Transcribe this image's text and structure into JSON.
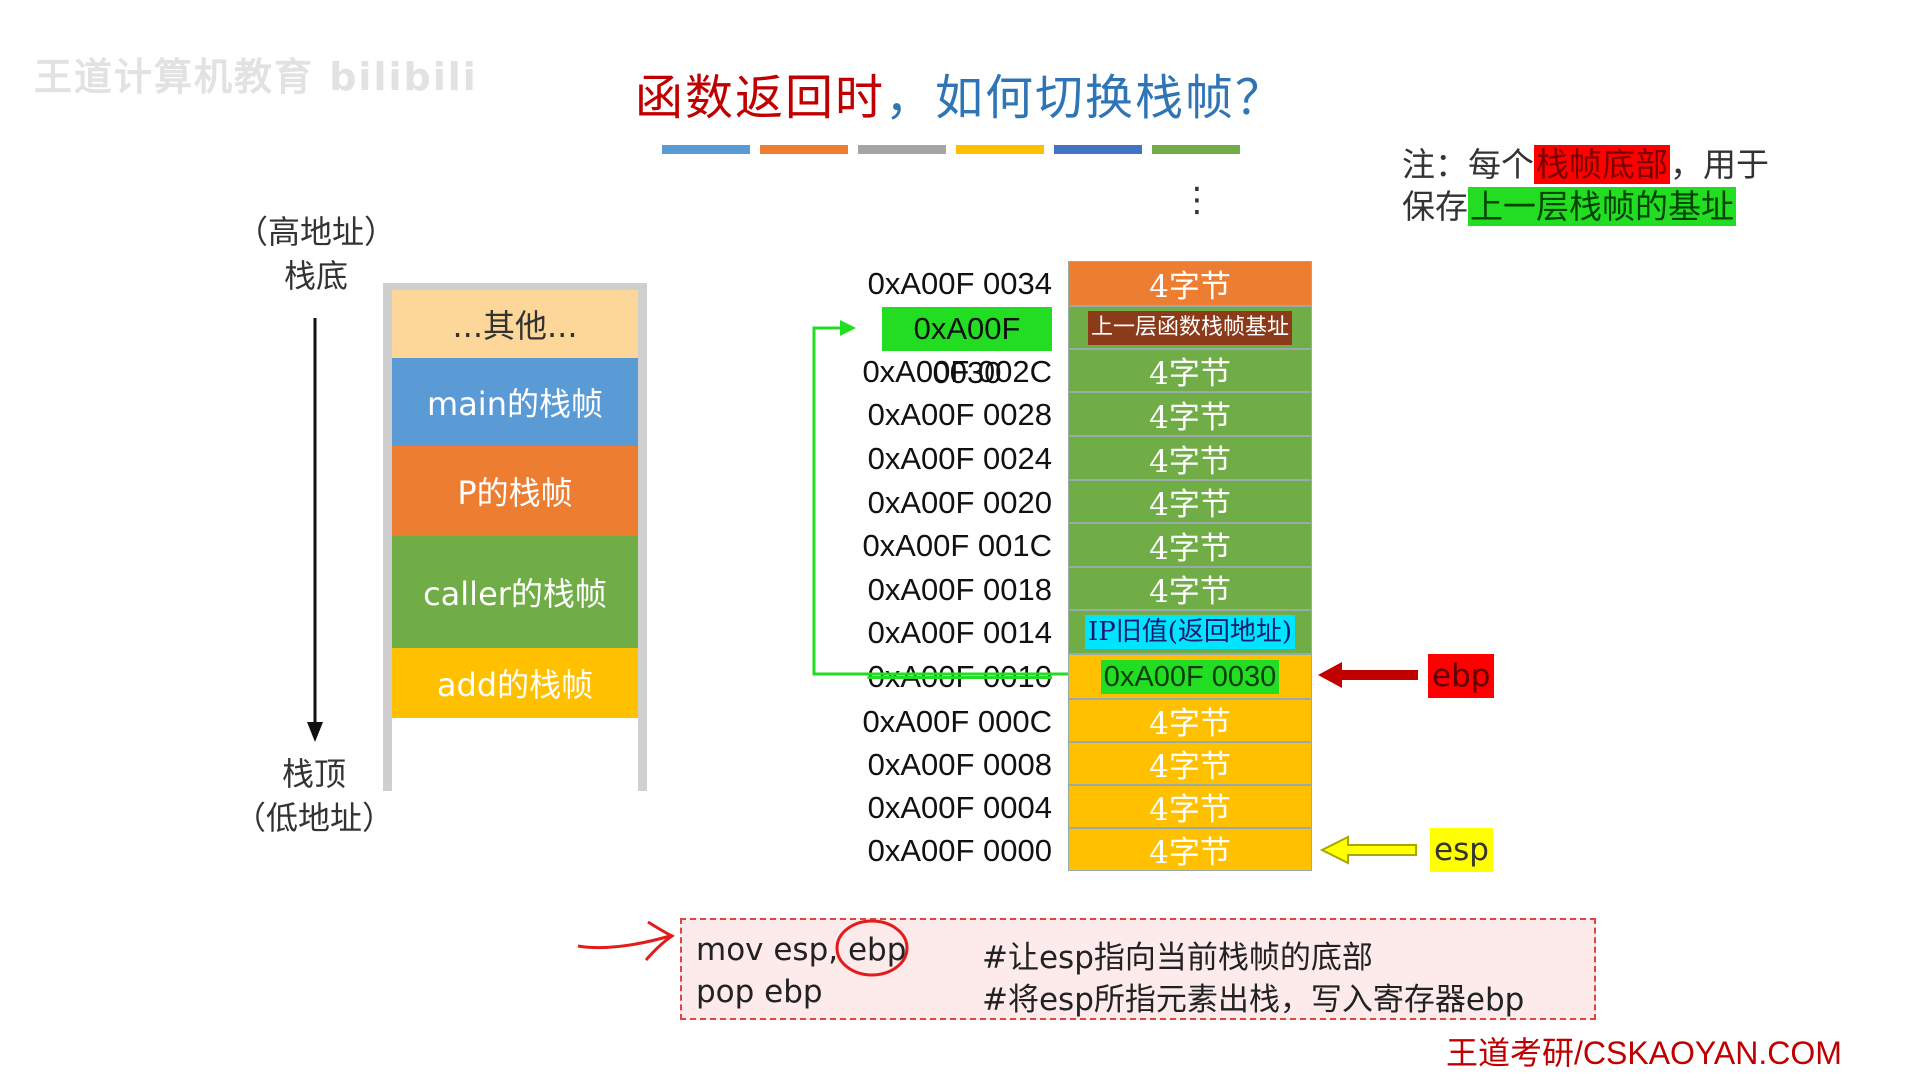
{
  "watermark": "王道计算机教育 bilibili",
  "title": {
    "prefix": "函数返回时",
    "suffix": "，如何切换栈帧？"
  },
  "color_bars": [
    "#5b9bd5",
    "#ed7d31",
    "#a5a5a5",
    "#ffc000",
    "#4472c4",
    "#70ad47"
  ],
  "note": {
    "line1_pre": "注：每个",
    "line1_hl": "栈帧底部",
    "line1_post": "，用于",
    "line2_pre": "保存",
    "line2_hl": "上一层栈帧的基址"
  },
  "stack_labels": {
    "top_paren": "（高地址）",
    "top": "栈底",
    "bottom": "栈顶",
    "bottom_paren": "（低地址）"
  },
  "frames": [
    {
      "label": "...其他...",
      "color": "#fdd699",
      "text_color": "#333333"
    },
    {
      "label": "main的栈帧",
      "color": "#5b9bd5",
      "text_color": "#ffffff"
    },
    {
      "label": "P的栈帧",
      "color": "#ed7d31",
      "text_color": "#ffffff"
    },
    {
      "label": "caller的栈帧",
      "color": "#70ad47",
      "text_color": "#ffffff"
    },
    {
      "label": "add的栈帧",
      "color": "#ffc000",
      "text_color": "#ffffff"
    }
  ],
  "ellipsis": "⋮",
  "memory": [
    {
      "addr": "0xA00F 0034",
      "value": "4字节",
      "color": "orange"
    },
    {
      "addr": "0xA00F 0030",
      "value": "上一层函数栈帧基址",
      "color": "green",
      "addr_highlight": true,
      "value_style": "dark-pill"
    },
    {
      "addr": "0xA00F 002C",
      "value": "4字节",
      "color": "green"
    },
    {
      "addr": "0xA00F 0028",
      "value": "4字节",
      "color": "green"
    },
    {
      "addr": "0xA00F 0024",
      "value": "4字节",
      "color": "green"
    },
    {
      "addr": "0xA00F 0020",
      "value": "4字节",
      "color": "green"
    },
    {
      "addr": "0xA00F 001C",
      "value": "4字节",
      "color": "green"
    },
    {
      "addr": "0xA00F 0018",
      "value": "4字节",
      "color": "green"
    },
    {
      "addr": "0xA00F 0014",
      "value": "IP旧值(返回地址)",
      "color": "green",
      "value_style": "cyan-pill"
    },
    {
      "addr": "0xA00F 0010",
      "value": "0xA00F 0030",
      "color": "yellow",
      "value_style": "green-pill",
      "strike": true
    },
    {
      "addr": "0xA00F 000C",
      "value": "4字节",
      "color": "yellow"
    },
    {
      "addr": "0xA00F 0008",
      "value": "4字节",
      "color": "yellow"
    },
    {
      "addr": "0xA00F 0004",
      "value": "4字节",
      "color": "yellow"
    },
    {
      "addr": "0xA00F 0000",
      "value": "4字节",
      "color": "yellow"
    }
  ],
  "pointers": {
    "ebp": "ebp",
    "esp": "esp"
  },
  "code": [
    {
      "instr": "mov esp, ebp",
      "comment": "#让esp指向当前栈帧的底部"
    },
    {
      "instr": "pop ebp",
      "comment": "#将esp所指元素出栈，写入寄存器ebp"
    }
  ],
  "brand": "王道考研/CSKAOYAN.COM"
}
